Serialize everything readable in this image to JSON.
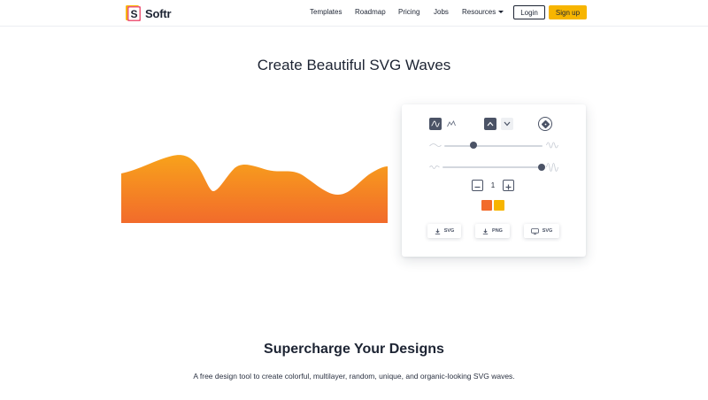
{
  "brand": {
    "name": "Softr",
    "letter": "S"
  },
  "nav": {
    "templates": "Templates",
    "roadmap": "Roadmap",
    "pricing": "Pricing",
    "jobs": "Jobs",
    "resources": "Resources"
  },
  "auth": {
    "login": "Login",
    "signup": "Sign up"
  },
  "hero": {
    "title": "Create Beautiful SVG Waves"
  },
  "controls": {
    "wave_types": [
      "smooth-wave-icon",
      "peak-wave-icon"
    ],
    "active_wave_type": "smooth-wave-icon",
    "directions": [
      "chevron-up-icon",
      "chevron-down-icon"
    ],
    "active_direction": "chevron-up-icon",
    "randomize_icon": "dice-icon",
    "complexity_level": 0.3,
    "contrast_level": 1.0,
    "layers": "1",
    "colors": [
      "#f26b2b",
      "#f7b500"
    ],
    "exports": [
      {
        "label": "SVG",
        "icon": "download-icon"
      },
      {
        "label": "PNG",
        "icon": "download-icon"
      },
      {
        "label": "SVG",
        "icon": "code-icon"
      }
    ]
  },
  "wave_colors": {
    "top": "#f8a21b",
    "bottom": "#f26b2b"
  },
  "section": {
    "title": "Supercharge Your Designs",
    "description": "A free design tool to create colorful, multilayer, random, unique, and organic-looking SVG waves."
  }
}
